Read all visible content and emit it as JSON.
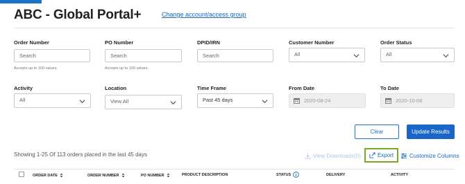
{
  "header": {
    "title": "ABC - Global Portal+",
    "change_link": "Change account/access group"
  },
  "filters": {
    "order_number": {
      "label": "Order Number",
      "placeholder": "Search",
      "hint": "Accepts up to 100 values."
    },
    "po_number": {
      "label": "PO Number",
      "placeholder": "Search",
      "hint": "Accepts up to 100 values."
    },
    "dpid": {
      "label": "DPID/IRN",
      "placeholder": "Search"
    },
    "customer_number": {
      "label": "Customer Number",
      "value": "All"
    },
    "order_status": {
      "label": "Order Status",
      "value": "All"
    },
    "activity": {
      "label": "Activity",
      "value": "All"
    },
    "location": {
      "label": "Location",
      "value": "View All"
    },
    "time_frame": {
      "label": "Time Frame",
      "value": "Past 45 days"
    },
    "from_date": {
      "label": "From Date",
      "value": "2020-08-24"
    },
    "to_date": {
      "label": "To Date",
      "value": "2020-10-08"
    }
  },
  "actions": {
    "clear": "Clear",
    "update": "Update Results"
  },
  "results": {
    "summary": "Showing 1-25 Of 113 orders placed in the last 45 days",
    "view_downloads": "View Downloads(0)",
    "export": "Export",
    "customize_columns": "Customize Columns"
  },
  "table": {
    "columns": {
      "order_date": "ORDER DATE",
      "order_number": "ORDER NUMBER",
      "po_number": "PO NUMBER",
      "product_description": "PRODUCT DESCRIPTION",
      "status": "STATUS",
      "delivery": "DELIVERY",
      "activity": "ACTIVITY"
    }
  },
  "colors": {
    "accent": "#1a73c8",
    "export_highlight": "#77aa22"
  }
}
